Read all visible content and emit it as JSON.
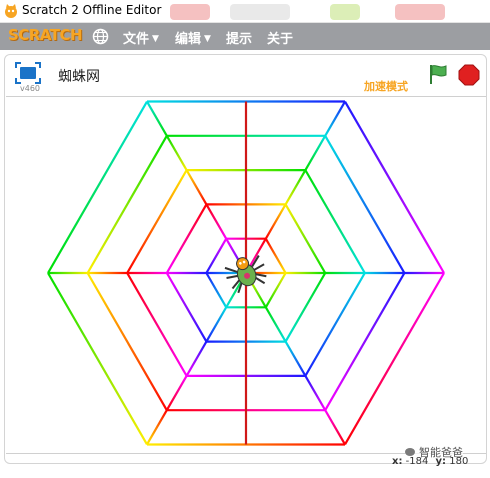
{
  "window": {
    "title": "Scratch 2 Offline Editor"
  },
  "menubar": {
    "logo": "SCRATCH",
    "items": [
      {
        "label": "文件",
        "has_caret": true
      },
      {
        "label": "编辑",
        "has_caret": true
      },
      {
        "label": "提示",
        "has_caret": false
      },
      {
        "label": "关于",
        "has_caret": false
      }
    ]
  },
  "stage_header": {
    "version": "v460",
    "project_title": "蜘蛛网",
    "turbo_mode": "加速模式"
  },
  "stage": {
    "spokes": 6,
    "rings": 5,
    "sprite": "spider"
  },
  "coords": {
    "x_label": "x:",
    "x_value": "-184",
    "y_label": "y:",
    "y_value": "180"
  },
  "watermark": "智能爸爸",
  "colors": {
    "menubar": "#9c9ea2",
    "logo": "#f7a523",
    "turbo": "#f7a523",
    "flag": "#4caf50",
    "stop": "#e02020",
    "spoke": "#d01818"
  }
}
